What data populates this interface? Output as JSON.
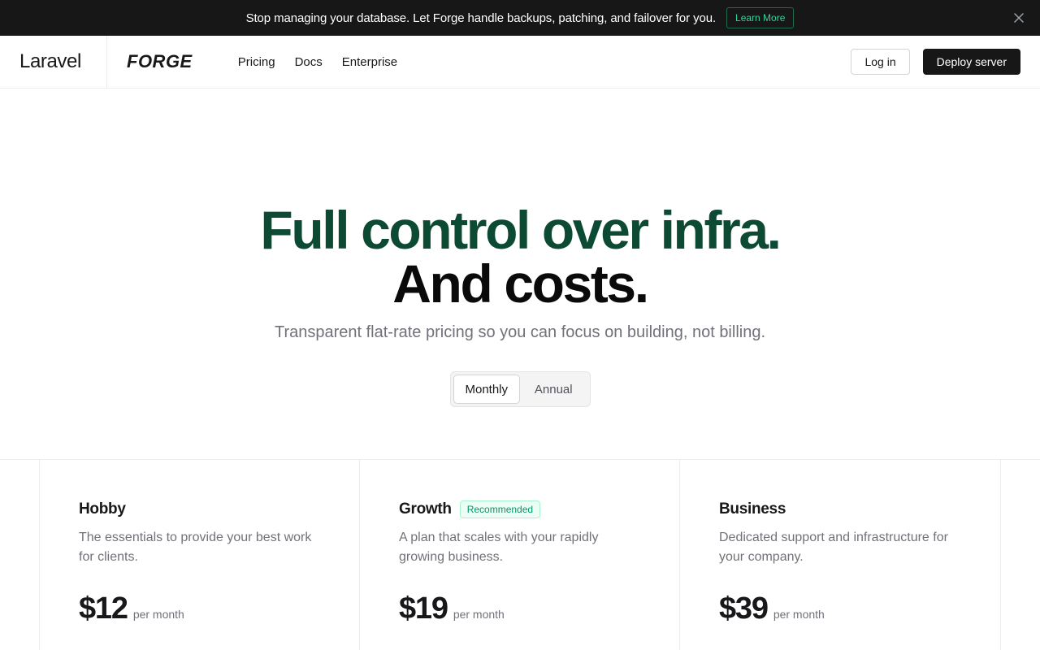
{
  "banner": {
    "text": "Stop managing your database. Let Forge handle backups, patching, and failover for you.",
    "cta": "Learn More",
    "close_icon": "close-icon"
  },
  "nav": {
    "brand": "Laravel",
    "product": "FORGE",
    "links": [
      "Pricing",
      "Docs",
      "Enterprise"
    ],
    "login": "Log in",
    "deploy": "Deploy server"
  },
  "hero": {
    "line1": "Full control over infra.",
    "line2": "And costs.",
    "subtitle": "Transparent flat-rate pricing so you can focus on building, not billing."
  },
  "billing_toggle": {
    "options": [
      "Monthly",
      "Annual"
    ],
    "selected": "Monthly"
  },
  "plans": [
    {
      "name": "Hobby",
      "badge": "",
      "description": "The essentials to provide your best work for clients.",
      "price": "$12",
      "period": "per month"
    },
    {
      "name": "Growth",
      "badge": "Recommended",
      "description": "A plan that scales with your rapidly growing business.",
      "price": "$19",
      "period": "per month"
    },
    {
      "name": "Business",
      "badge": "",
      "description": "Dedicated support and infrastructure for your company.",
      "price": "$39",
      "period": "per month"
    }
  ],
  "colors": {
    "banner_bg": "#171717",
    "accent_green": "#0c4a33",
    "badge_green": "#059669"
  }
}
